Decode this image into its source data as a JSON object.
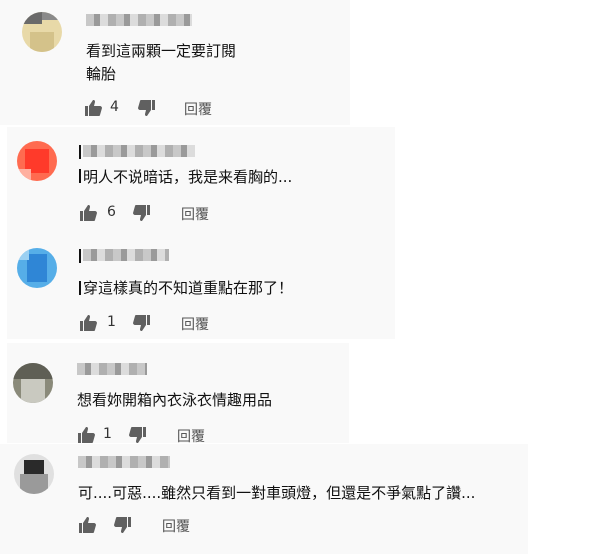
{
  "comments": [
    {
      "text_lines": [
        "看到這兩顆一定要訂閱",
        "輪胎"
      ],
      "likes": "4",
      "reply_label": "回覆",
      "avatar_colors": [
        "#e8d9a8",
        "#d4c28a",
        "#b8b8b8"
      ]
    },
    {
      "text_lines": [
        "明人不说暗话，我是来看胸的..."
      ],
      "likes": "6",
      "reply_label": "回覆",
      "avatar_colors": [
        "#ff6b50",
        "#ff3a2a",
        "#ffb0a0"
      ]
    },
    {
      "text_lines": [
        "穿這樣真的不知道重點在那了！"
      ],
      "likes": "1",
      "reply_label": "回覆",
      "avatar_colors": [
        "#56aee8",
        "#2f86d6",
        "#9bd0f2"
      ]
    },
    {
      "text_lines": [
        "想看妳開箱內衣泳衣情趣用品"
      ],
      "likes": "1",
      "reply_label": "回覆",
      "avatar_colors": [
        "#8a8a7a",
        "#5f5f55",
        "#c9c9c0"
      ]
    },
    {
      "text_lines": [
        "可....可惡....雖然只看到一對車頭燈，但還是不爭氣點了讚..."
      ],
      "likes": "",
      "reply_label": "回覆",
      "avatar_colors": [
        "#2a2a2a",
        "#9a9a9a",
        "#e0e0e0"
      ]
    }
  ]
}
